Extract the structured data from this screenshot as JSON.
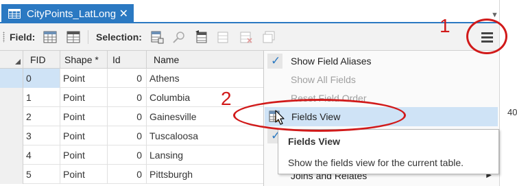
{
  "tab": {
    "title": "CityPoints_LatLong",
    "close_glyph": "✕",
    "icon": "table-icon"
  },
  "tab_dropdown_glyph": "▼",
  "gutter_text": "40",
  "toolbar": {
    "field_label": "Field:",
    "selection_label": "Selection:",
    "menu_icon": "hamburger-menu-icon"
  },
  "table": {
    "columns": [
      "FID",
      "Shape *",
      "Id",
      "Name"
    ],
    "rows": [
      {
        "fid": "0",
        "shape": "Point",
        "id": "0",
        "name": "Athens"
      },
      {
        "fid": "1",
        "shape": "Point",
        "id": "0",
        "name": "Columbia"
      },
      {
        "fid": "2",
        "shape": "Point",
        "id": "0",
        "name": "Gainesville"
      },
      {
        "fid": "3",
        "shape": "Point",
        "id": "0",
        "name": "Tuscaloosa"
      },
      {
        "fid": "4",
        "shape": "Point",
        "id": "0",
        "name": "Lansing"
      },
      {
        "fid": "5",
        "shape": "Point",
        "id": "0",
        "name": "Pittsburgh"
      }
    ]
  },
  "menu": {
    "items": [
      {
        "label": "Show Field Aliases",
        "checked": true,
        "enabled": true
      },
      {
        "label": "Show All Fields",
        "checked": false,
        "enabled": false
      },
      {
        "label": "Reset Field Order",
        "checked": false,
        "enabled": false
      },
      {
        "label": "Fields View",
        "checked": false,
        "enabled": true,
        "hovered": true,
        "icon": "fields-view-icon"
      },
      {
        "label": "",
        "checked": true,
        "enabled": true
      },
      {
        "label": "",
        "checked": false,
        "enabled": true
      },
      {
        "label": "Joins and Relates",
        "checked": false,
        "enabled": true,
        "submenu": true
      }
    ],
    "check_glyph": "✓",
    "submenu_glyph": "▶"
  },
  "tooltip": {
    "title": "Fields View",
    "body": "Show the fields view for the current table."
  },
  "annotations": {
    "label_1": "1",
    "label_2": "2",
    "color": "#d11a1a"
  },
  "colors": {
    "accent": "#2b79c2",
    "selection": "#cfe3f6"
  }
}
